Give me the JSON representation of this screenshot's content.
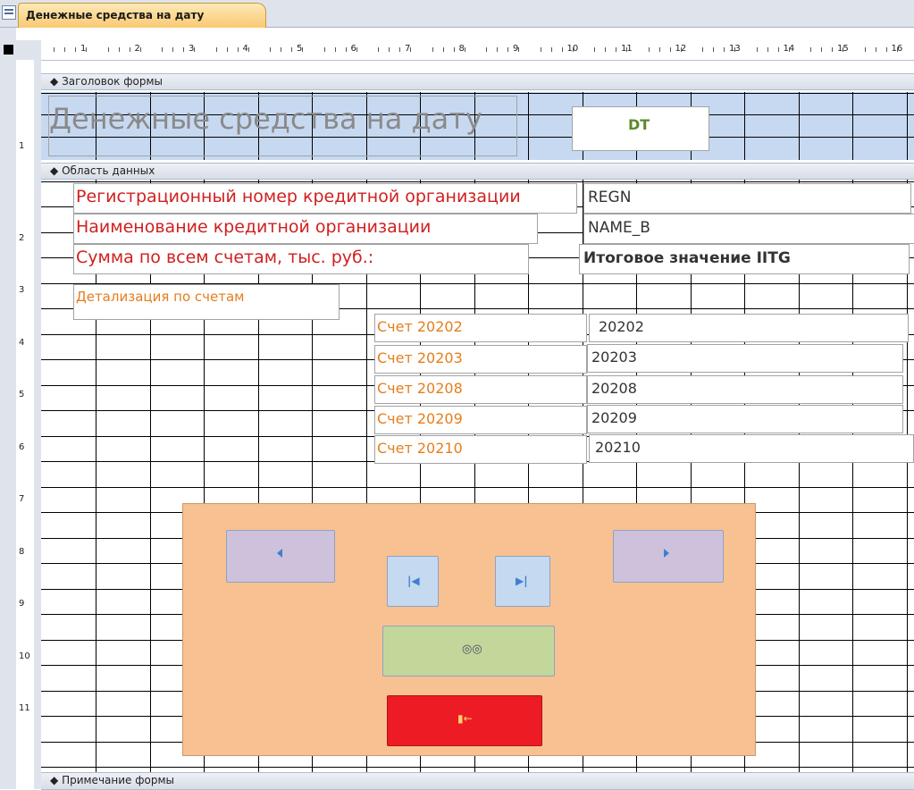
{
  "tab": {
    "icon": "form-icon",
    "title": "Денежные средства на дату"
  },
  "ruler": {
    "h_marks": [
      "1",
      "2",
      "3",
      "4",
      "5",
      "6",
      "7",
      "8",
      "9",
      "10",
      "11",
      "12",
      "13",
      "14",
      "15",
      "16"
    ],
    "v_marks": [
      "1",
      "2",
      "3",
      "4",
      "5",
      "6",
      "7",
      "8",
      "9",
      "10",
      "11"
    ]
  },
  "sections": {
    "header": "Заголовок формы",
    "detail": "Область данных",
    "footer": "Примечание формы"
  },
  "header": {
    "title": "Денежные средства на дату",
    "date_field": "DT"
  },
  "detail": {
    "regn_label": "Регистрационный номер кредитной организации",
    "regn_field": "REGN",
    "name_label": "Наименование кредитной организации",
    "name_field": "NAME_B",
    "sum_label": "Сумма по всем счетам, тыс. руб.:",
    "sum_field": "Итоговое значение IITG",
    "detail_label": "Детализация по счетам",
    "accounts": [
      {
        "label": "Счет 20202",
        "field": "20202"
      },
      {
        "label": "Счет 20203",
        "field": "20203"
      },
      {
        "label": "Счет 20208",
        "field": "20208"
      },
      {
        "label": "Счет 20209",
        "field": "20209"
      },
      {
        "label": "Счет 20210",
        "field": "20210"
      }
    ]
  },
  "buttons": {
    "prev_icon": "triangle-left-icon",
    "next_icon": "triangle-right-icon",
    "first_icon": "first-record-icon",
    "last_icon": "last-record-icon",
    "find_icon": "binoculars-icon",
    "exit_icon": "exit-door-icon"
  },
  "colors": {
    "nav_panel": "#f8c192",
    "nav_button": "#cdc1dc",
    "first_last_button": "#c5d9f1",
    "find_button": "#c4d79b",
    "exit_button": "#ed1c24",
    "header_band": "#c7d9f1",
    "label_red": "#d02020",
    "label_orange": "#e57e1c"
  }
}
